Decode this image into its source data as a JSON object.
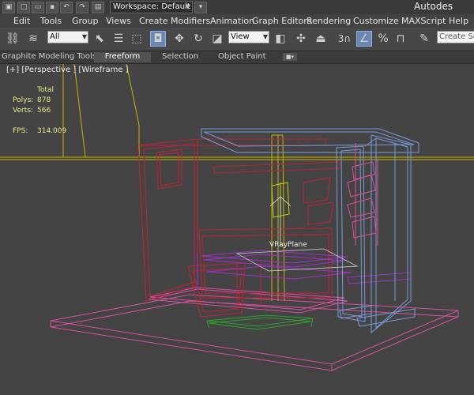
{
  "titlebar": {
    "workspace_label": "Workspace: Default",
    "app_title": "Autodes"
  },
  "menu": [
    "Edit",
    "Tools",
    "Group",
    "Views",
    "Create",
    "Modifiers",
    "Animation",
    "Graph Editors",
    "Rendering",
    "Customize",
    "MAXScript",
    "Help"
  ],
  "toolbar": {
    "selection_filter": "All",
    "ref_coord": "View",
    "snap_value": "3",
    "named_selection_placeholder": "Create Selec"
  },
  "ribbon": {
    "title": "Graphite Modeling Tools",
    "tabs": [
      "Freeform",
      "Selection",
      "Object Paint"
    ]
  },
  "viewport": {
    "label": "[+] [Perspective ] [Wireframe ]",
    "stats": {
      "header": "Total",
      "polys_label": "Polys:",
      "polys": "878",
      "verts_label": "Verts:",
      "verts": "566",
      "fps_label": "FPS:",
      "fps": "314.009"
    },
    "object_label": "VRayPlane",
    "colors": {
      "background": "#444444",
      "red": "#c0223a",
      "pink": "#d94f9e",
      "purple": "#a030c8",
      "blue": "#7a9ad8",
      "yellow": "#c8b400",
      "green": "#30a030"
    }
  }
}
